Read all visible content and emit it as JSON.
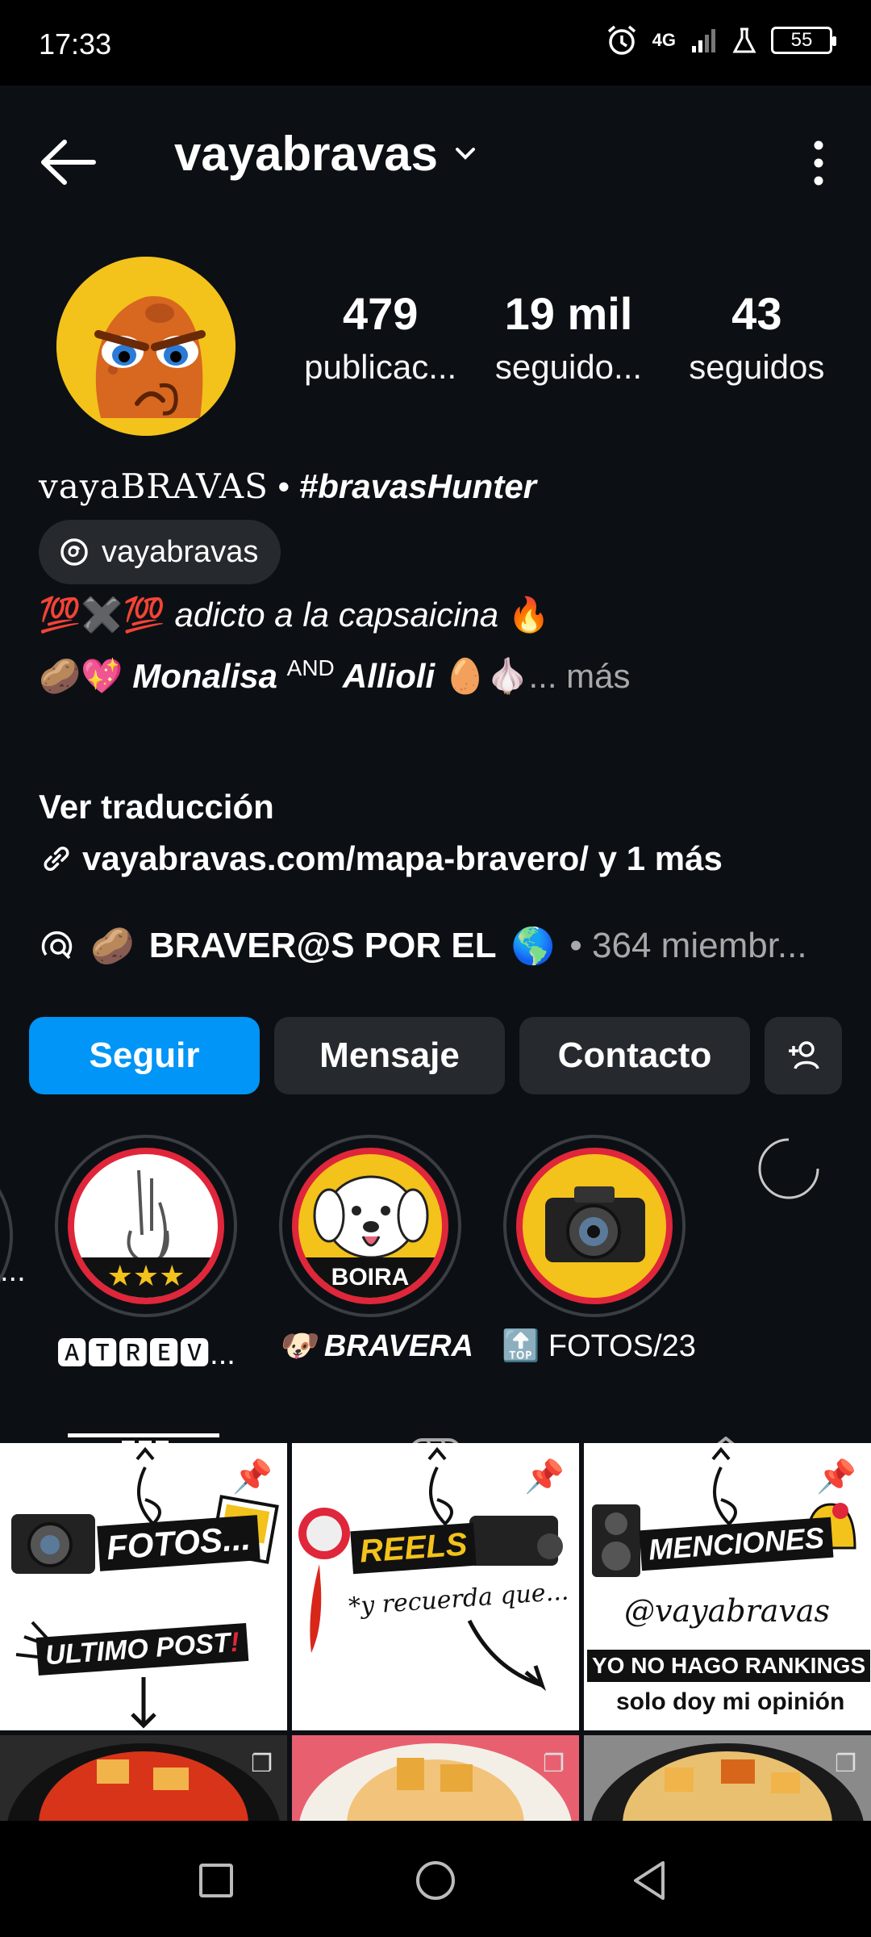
{
  "status_bar": {
    "time": "17:33",
    "network": "4G",
    "battery": "55"
  },
  "header": {
    "username": "vayabravas"
  },
  "stats": [
    {
      "value": "479",
      "label": "publicac..."
    },
    {
      "value": "19 mil",
      "label": "seguido..."
    },
    {
      "value": "43",
      "label": "seguidos"
    }
  ],
  "profile": {
    "name": "vayaBRAVAS",
    "separator": " • ",
    "hashtag": "#bravasHunter",
    "threads_handle": "vayabravas",
    "bio_line1_emoji_left": "💯✖️💯",
    "bio_line1_text": " adicto a la capsaicina ",
    "bio_line1_emoji_right": "🔥",
    "bio_line2_emoji": "🥔💖",
    "bio_line2_a": " Monalisa ",
    "bio_line2_and": "AND",
    "bio_line2_b": " Allioli ",
    "bio_line2_emoji_end": "🥚🧄",
    "bio_more": "... más",
    "translate": "Ver traducción",
    "link": "vayabravas.com/mapa-bravero/ y 1 más"
  },
  "channel": {
    "emoji": "🥔",
    "name": "BRAVER@S POR EL",
    "emoji_end": "🌎",
    "members": " • 364 miembr..."
  },
  "buttons": {
    "follow": "Seguir",
    "message": "Mensaje",
    "contact": "Contacto"
  },
  "highlights": [
    {
      "label": "🅰🆃🆁🅴🆅...",
      "badge": "★★★"
    },
    {
      "label": "🐶 BRAVERA",
      "badge": "BOIRA"
    },
    {
      "label": "🔝 FOTOS/23",
      "badge": ""
    }
  ],
  "partial_highlight_label": "...",
  "grid_posts": [
    {
      "title_a": "FOTOS...",
      "title_b": "ULTIMO POST",
      "title_b_suffix": "!"
    },
    {
      "title_a": "REELS",
      "title_b": "*y recuerda que..."
    },
    {
      "title_a": "MENCIONES",
      "title_b": "@vayabravas",
      "title_c": "YO NO HAGO RANKINGS",
      "title_d": "solo doy mi opinión"
    }
  ],
  "colors": {
    "background": "#0c1014",
    "accent": "#0095f6",
    "button": "#262a2e"
  }
}
